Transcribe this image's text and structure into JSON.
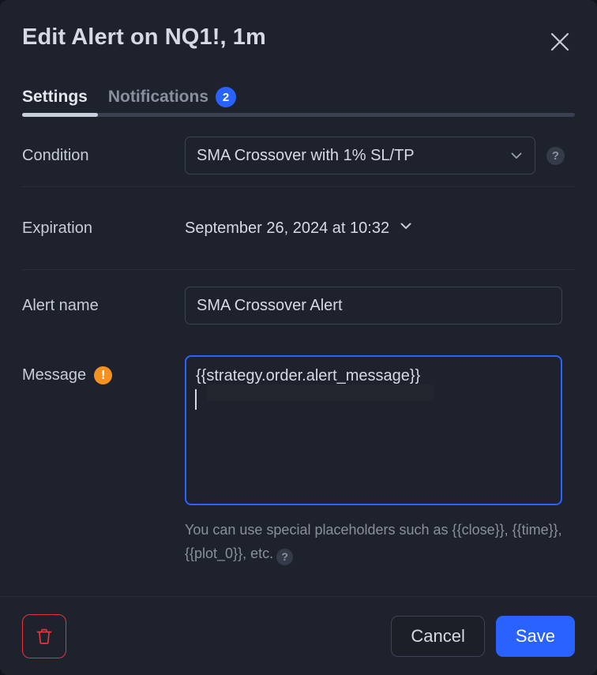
{
  "dialog": {
    "title": "Edit Alert on NQ1!, 1m",
    "close_icon": "close-icon"
  },
  "tabs": {
    "items": [
      {
        "label": "Settings",
        "badge": "",
        "active": true
      },
      {
        "label": "Notifications",
        "badge": "2",
        "active": false
      }
    ]
  },
  "settings": {
    "condition": {
      "label": "Condition",
      "value": "SMA Crossover with 1% SL/TP",
      "chevron_icon": "chevron-down-icon",
      "help_icon": "?"
    },
    "expiration": {
      "label": "Expiration",
      "value": "September 26, 2024 at 10:32",
      "chevron_icon": "chevron-down-icon"
    },
    "alert_name": {
      "label": "Alert name",
      "value": "SMA Crossover Alert",
      "placeholder": "Alert name"
    },
    "message": {
      "label": "Message",
      "warning_icon": "!",
      "value": "{{strategy.order.alert_message}}\n",
      "placeholder": "Message",
      "hint": "You can use special placeholders such as {{close}}, {{time}}, {{plot_0}}, etc.",
      "hint_help_icon": "?"
    }
  },
  "footer": {
    "delete_icon": "trash-icon",
    "cancel_label": "Cancel",
    "save_label": "Save"
  },
  "colors": {
    "background": "#1e222d",
    "accent": "#2962ff",
    "warning": "#f59120",
    "danger": "#e5343e",
    "text_primary": "#d6dae4",
    "text_secondary": "#8a8f9e",
    "border": "#3d4354"
  }
}
